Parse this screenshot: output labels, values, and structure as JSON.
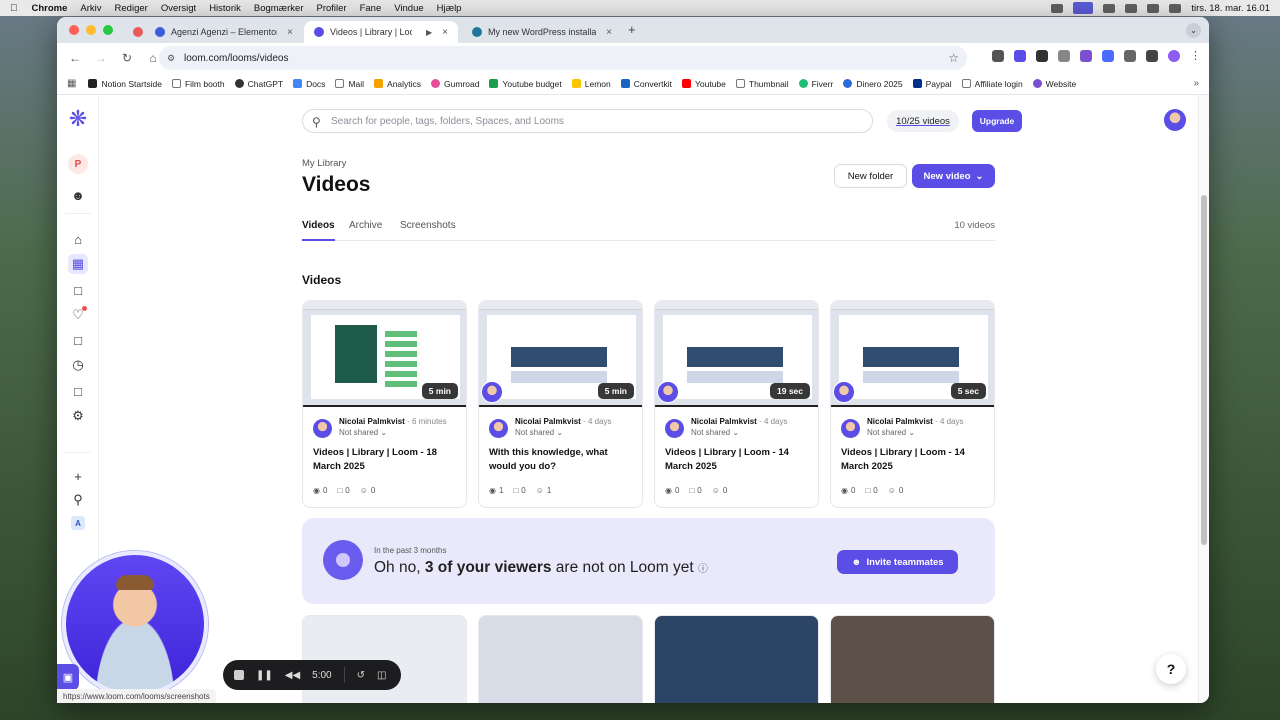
{
  "menubar": {
    "app": "Chrome",
    "items": [
      "Arkiv",
      "Rediger",
      "Oversigt",
      "Historik",
      "Bogmærker",
      "Profiler",
      "Fane",
      "Vindue",
      "Hjælp"
    ],
    "clock": "tirs. 18. mar.  16.01"
  },
  "tabs": [
    {
      "title": "Agenzi Agenzi – Elementor Te",
      "fav_color": "#3b5bdb"
    },
    {
      "title": "Videos | Library | Loom",
      "fav_color": "#5b4ee6"
    },
    {
      "title": "My new WordPress installatio",
      "fav_color": "#21759b"
    }
  ],
  "address": {
    "url": "loom.com/looms/videos"
  },
  "bookmarks": [
    {
      "label": "Notion Startside",
      "color": "#222"
    },
    {
      "label": "Film booth",
      "color": "#777"
    },
    {
      "label": "ChatGPT",
      "color": "#333"
    },
    {
      "label": "Docs",
      "color": "#4285f4"
    },
    {
      "label": "Mail",
      "color": "#777"
    },
    {
      "label": "Analytics",
      "color": "#f4a200"
    },
    {
      "label": "Gumroad",
      "color": "#e84b9a"
    },
    {
      "label": "Youtube budget",
      "color": "#1e9e4a"
    },
    {
      "label": "Lemon",
      "color": "#f7c600"
    },
    {
      "label": "Convertkit",
      "color": "#1766c3"
    },
    {
      "label": "Youtube",
      "color": "#ff0000"
    },
    {
      "label": "Thumbnail",
      "color": "#777"
    },
    {
      "label": "Fiverr",
      "color": "#1dbf73"
    },
    {
      "label": "Dinero 2025",
      "color": "#2a6bd8"
    },
    {
      "label": "Paypal",
      "color": "#003087"
    },
    {
      "label": "Affiliate login",
      "color": "#777"
    },
    {
      "label": "Website",
      "color": "#7a4fd0"
    }
  ],
  "header": {
    "search_placeholder": "Search for people, tags, folders, Spaces, and Looms",
    "quota": "10/25 videos",
    "upgrade": "Upgrade"
  },
  "rail": {
    "workspace_initial": "P",
    "bottom_initial": "A"
  },
  "library": {
    "breadcrumb": "My Library",
    "title": "Videos",
    "new_folder": "New folder",
    "new_video": "New video",
    "tabs": [
      "Videos",
      "Archive",
      "Screenshots"
    ],
    "count": "10 videos",
    "section": "Videos"
  },
  "videos": [
    {
      "duration": "5 min",
      "author": "Nicolai Palmkvist",
      "ago": "6 minutes",
      "shared": "Not shared",
      "title": "Videos | Library | Loom - 18 March 2025",
      "views": "0",
      "comments": "0",
      "reactions": "0"
    },
    {
      "duration": "5 min",
      "author": "Nicolai Palmkvist",
      "ago": "4 days",
      "shared": "Not shared",
      "title": "With this knowledge, what would you do?",
      "views": "1",
      "comments": "0",
      "reactions": "1"
    },
    {
      "duration": "19 sec",
      "author": "Nicolai Palmkvist",
      "ago": "4 days",
      "shared": "Not shared",
      "title": "Videos | Library | Loom - 14 March 2025",
      "views": "0",
      "comments": "0",
      "reactions": "0"
    },
    {
      "duration": "5 sec",
      "author": "Nicolai Palmkvist",
      "ago": "4 days",
      "shared": "Not shared",
      "title": "Videos | Library | Loom - 14 March 2025",
      "views": "0",
      "comments": "0",
      "reactions": "0"
    }
  ],
  "banner": {
    "pre": "In the past 3 months",
    "text_start": "Oh no, ",
    "text_bold": "3 of your viewers",
    "text_end": " are not on Loom yet",
    "invite": "Invite teammates"
  },
  "recorder": {
    "time": "5:00"
  },
  "status_url": "https://www.loom.com/looms/screenshots",
  "colors": {
    "accent": "#5b4ee6"
  }
}
